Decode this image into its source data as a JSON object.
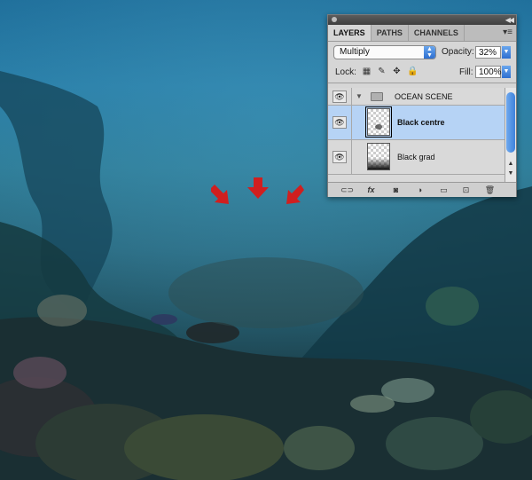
{
  "layers_panel": {
    "tabs": [
      "LAYERS",
      "PATHS",
      "CHANNELS"
    ],
    "blend_mode": "Multiply",
    "opacity_label": "Opacity:",
    "opacity_value": "32%",
    "lock_label": "Lock:",
    "fill_label": "Fill:",
    "fill_value": "100%",
    "layers": [
      {
        "name": "OCEAN SCENE",
        "type": "group"
      },
      {
        "name": "Black centre",
        "selected": true
      },
      {
        "name": "Black grad"
      }
    ],
    "bottom_icons": [
      "link-icon",
      "fx-icon",
      "mask-icon",
      "adjustment-icon",
      "new-group-icon",
      "new-layer-icon",
      "trash-icon"
    ]
  },
  "annotations": {
    "arrow_color": "#d01f1f",
    "arrow_count": 3
  }
}
